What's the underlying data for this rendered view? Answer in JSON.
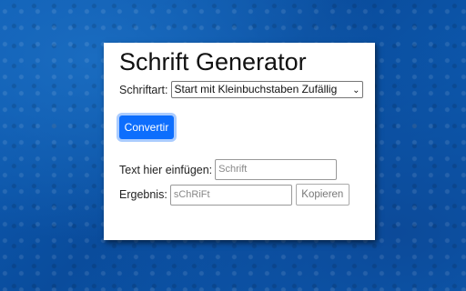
{
  "app": {
    "title": "Schrift Generator"
  },
  "font_select": {
    "label": "Schriftart:",
    "selected": "Start mit Kleinbuchstaben Zufällig"
  },
  "convert_button": {
    "label": "Convertir",
    "color": "#0d6efd"
  },
  "text_input": {
    "label": "Text hier einfügen:",
    "placeholder": "Schrift"
  },
  "result": {
    "label": "Ergebnis:",
    "value": "sChRiFt"
  },
  "copy_button": {
    "label": "Kopieren"
  }
}
